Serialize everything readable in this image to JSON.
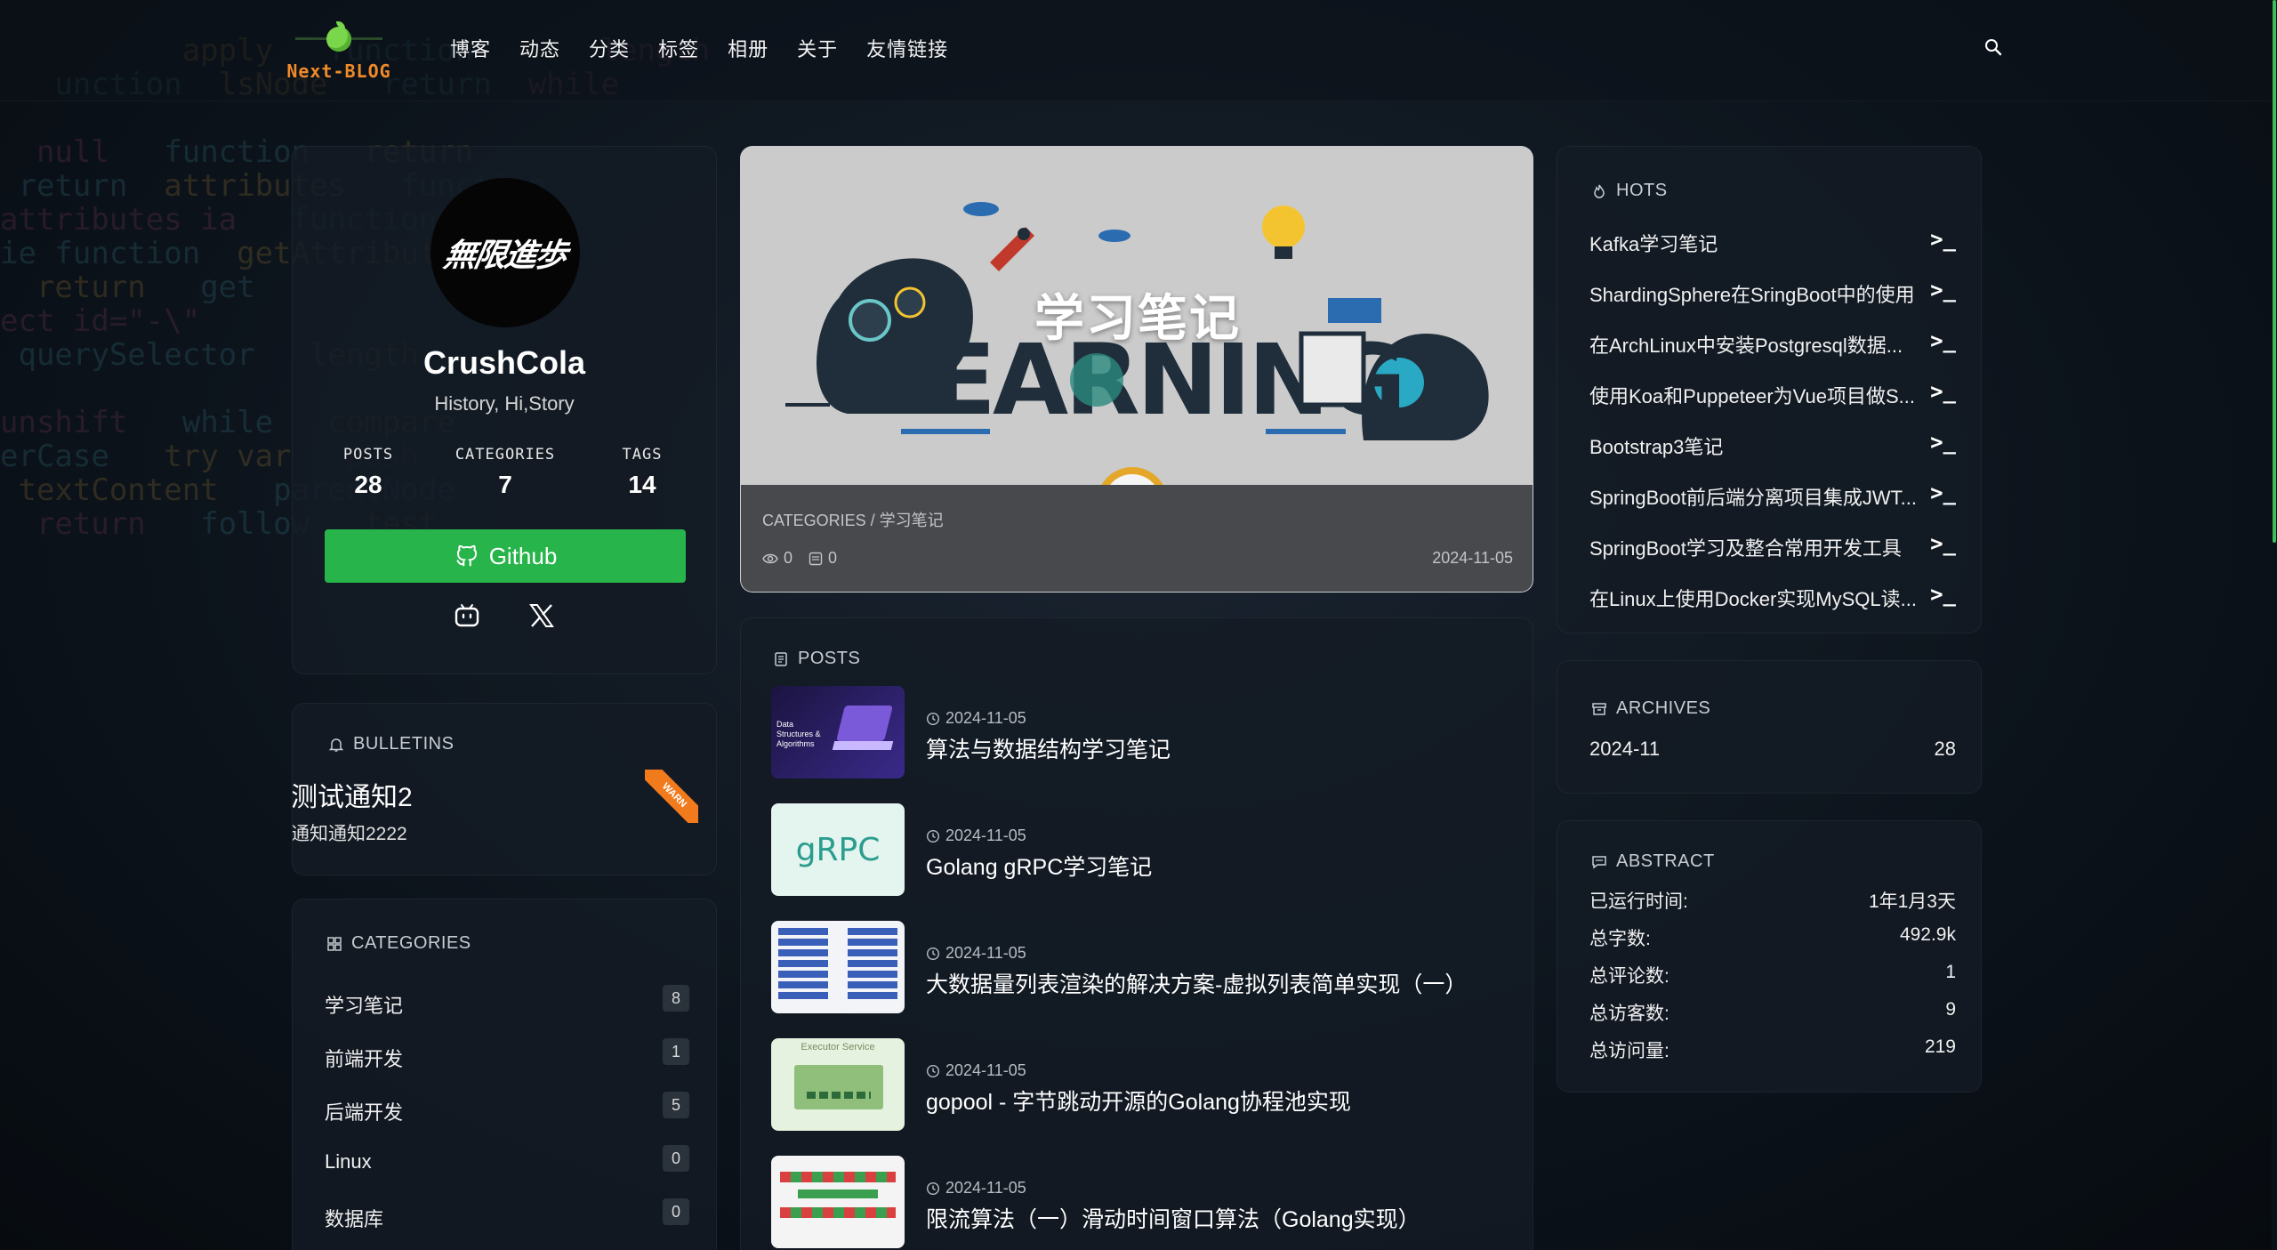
{
  "brand": {
    "name": "Next-BLOG"
  },
  "nav": {
    "items": [
      "博客",
      "动态",
      "分类",
      "标签",
      "相册",
      "关于",
      "友情链接"
    ]
  },
  "profile": {
    "avatar_text": "無限進歩",
    "name": "CrushCola",
    "desc": "History, Hi,Story",
    "stats": [
      {
        "label": "POSTS",
        "value": "28"
      },
      {
        "label": "CATEGORIES",
        "value": "7"
      },
      {
        "label": "TAGS",
        "value": "14"
      }
    ],
    "github_label": "Github",
    "socials": [
      "bilibili-icon",
      "x-icon"
    ]
  },
  "bulletins": {
    "title": "BULLETINS",
    "item_title": "测试通知2",
    "item_text": "通知通知2222",
    "ribbon": "WARN"
  },
  "categories": {
    "title": "CATEGORIES",
    "items": [
      {
        "name": "学习笔记",
        "count": "8"
      },
      {
        "name": "前端开发",
        "count": "1"
      },
      {
        "name": "后端开发",
        "count": "5"
      },
      {
        "name": "Linux",
        "count": "0"
      },
      {
        "name": "数据库",
        "count": "0"
      }
    ]
  },
  "featured": {
    "title": "学习笔记",
    "art_text": "LEARNING",
    "category": "CATEGORIES / 学习笔记",
    "views": "0",
    "comments": "0",
    "date": "2024-11-05"
  },
  "posts": {
    "title": "POSTS",
    "items": [
      {
        "date": "2024-11-05",
        "title": "算法与数据结构学习笔记",
        "thumb": "Data Structures & Algorithms"
      },
      {
        "date": "2024-11-05",
        "title": "Golang gRPC学习笔记",
        "thumb": "gRPC"
      },
      {
        "date": "2024-11-05",
        "title": "大数据量列表渲染的解决方案-虚拟列表简单实现（一）",
        "thumb": ""
      },
      {
        "date": "2024-11-05",
        "title": "gopool - 字节跳动开源的Golang协程池实现",
        "thumb": "Executor Service"
      },
      {
        "date": "2024-11-05",
        "title": "限流算法（一）滑动时间窗口算法（Golang实现）",
        "thumb": ""
      }
    ]
  },
  "hots": {
    "title": "HOTS",
    "arrow": ">_",
    "items": [
      "Kafka学习笔记",
      "ShardingSphere在SringBoot中的使用",
      "在ArchLinux中安装Postgresql数据...",
      "使用Koa和Puppeteer为Vue项目做S...",
      "Bootstrap3笔记",
      "SpringBoot前后端分离项目集成JWT...",
      "SpringBoot学习及整合常用开发工具",
      "在Linux上使用Docker实现MySQL读..."
    ]
  },
  "archives": {
    "title": "ARCHIVES",
    "items": [
      {
        "month": "2024-11",
        "count": "28"
      }
    ]
  },
  "abstract": {
    "title": "ABSTRACT",
    "items": [
      {
        "label": "已运行时间:",
        "value": "1年1月3天"
      },
      {
        "label": "总字数:",
        "value": "492.9k"
      },
      {
        "label": "总评论数:",
        "value": "1"
      },
      {
        "label": "总访客数:",
        "value": "9"
      },
      {
        "label": "总访问量:",
        "value": "219"
      }
    ]
  },
  "colors": {
    "accent": "#27b44a",
    "ribbon": "#f07a1c",
    "brand": "#f08a28"
  }
}
